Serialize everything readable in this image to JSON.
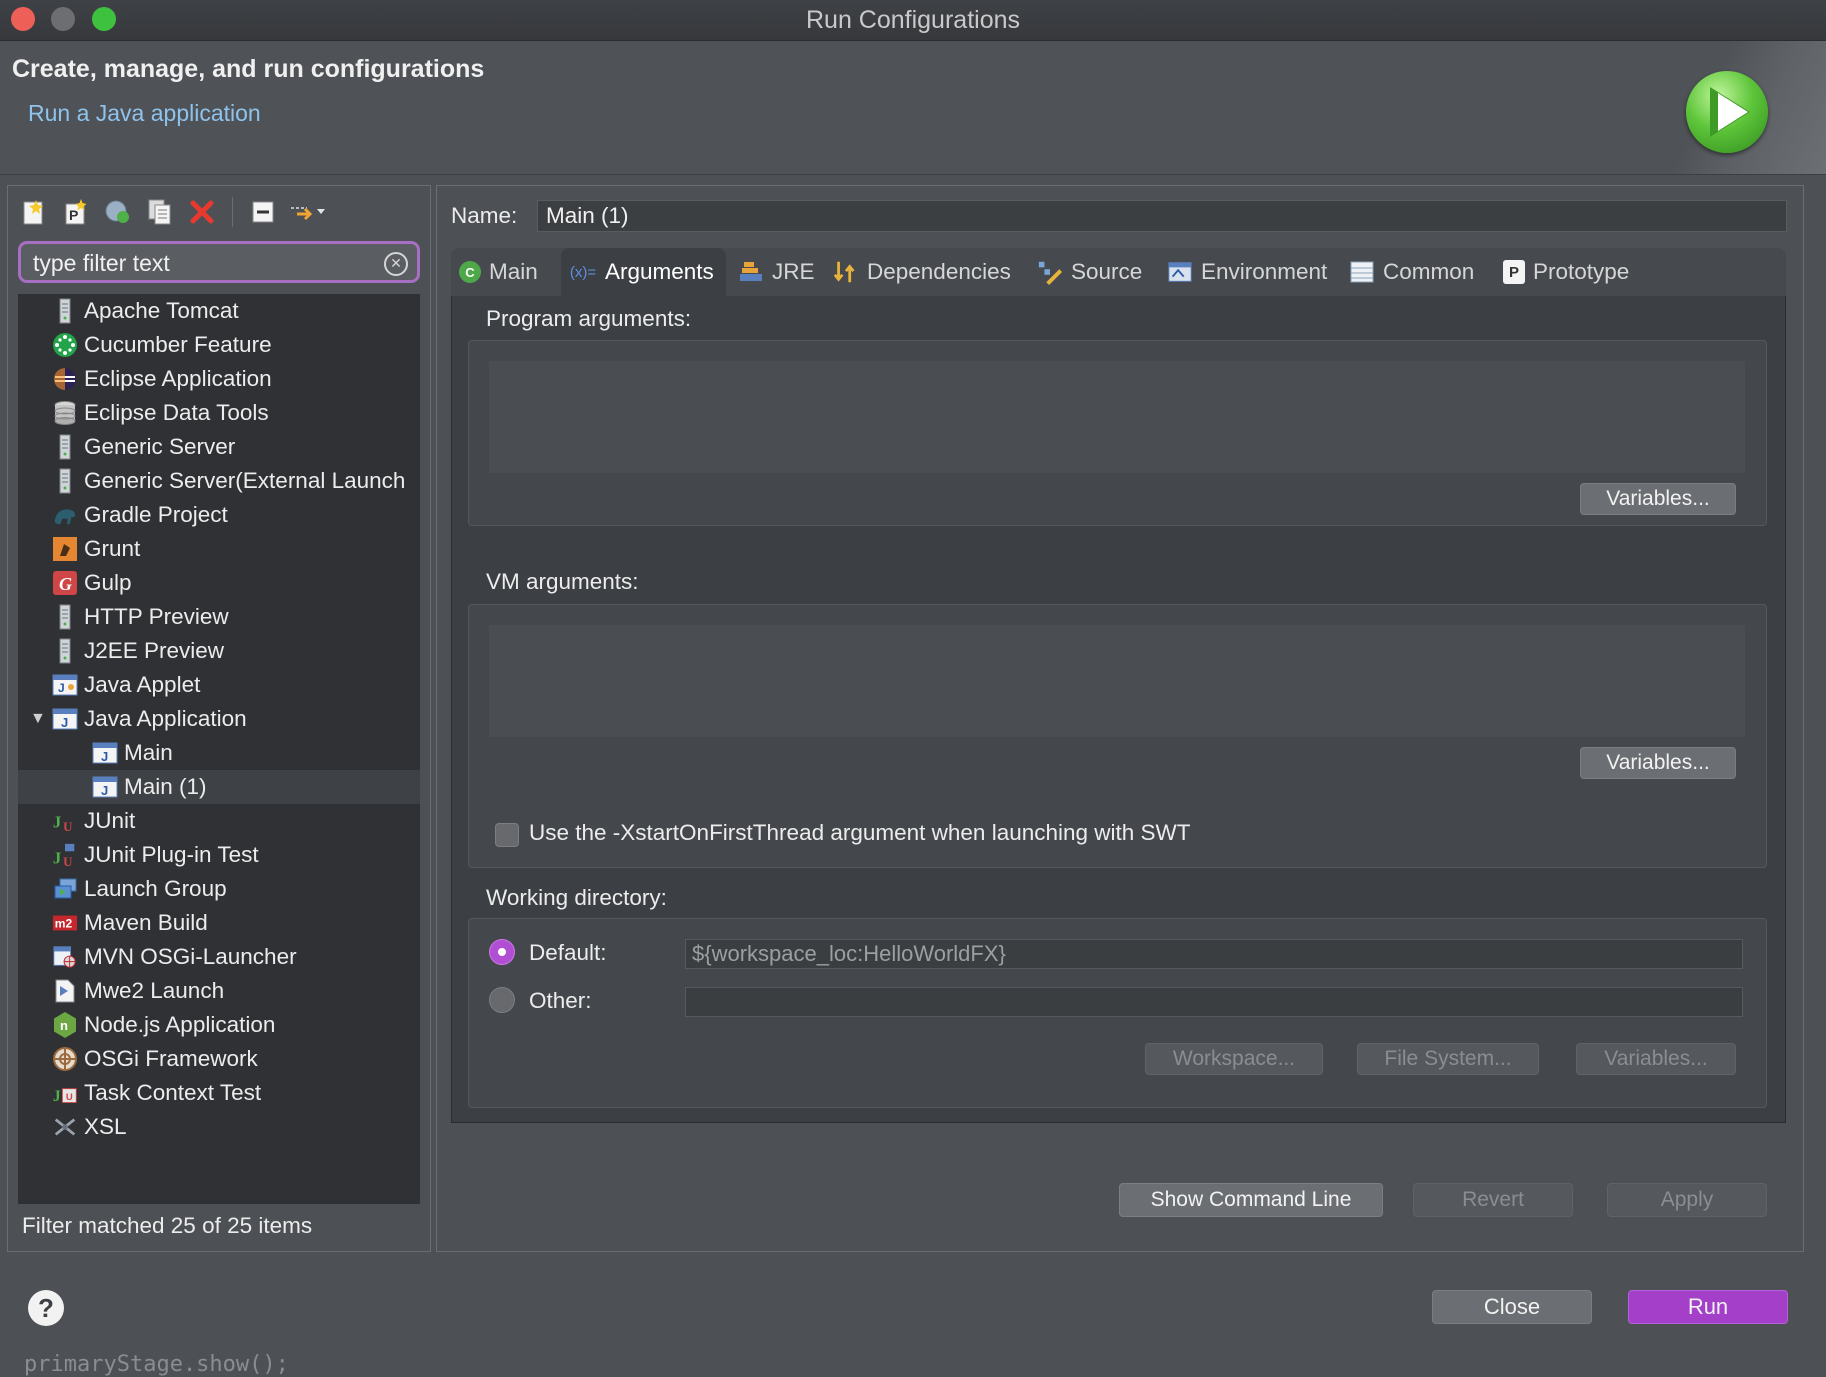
{
  "window": {
    "title": "Run Configurations"
  },
  "header": {
    "title": "Create, manage, and run configurations",
    "subtitle": "Run a Java application"
  },
  "left": {
    "toolbar": [
      "new-config-icon",
      "new-prototype-icon",
      "export-icon",
      "duplicate-icon",
      "delete-icon",
      "collapse-all-icon",
      "filter-menu-icon"
    ],
    "filter_placeholder": "type filter text",
    "tree": [
      {
        "label": "Apache Tomcat",
        "icon": "server-icon",
        "level": 0
      },
      {
        "label": "Cucumber Feature",
        "icon": "cucumber-icon",
        "level": 0
      },
      {
        "label": "Eclipse Application",
        "icon": "eclipse-icon",
        "level": 0
      },
      {
        "label": "Eclipse Data Tools",
        "icon": "database-icon",
        "level": 0
      },
      {
        "label": "Generic Server",
        "icon": "server-icon",
        "level": 0
      },
      {
        "label": "Generic Server(External Launch",
        "icon": "server-icon",
        "level": 0
      },
      {
        "label": "Gradle Project",
        "icon": "gradle-icon",
        "level": 0
      },
      {
        "label": "Grunt",
        "icon": "grunt-icon",
        "level": 0
      },
      {
        "label": "Gulp",
        "icon": "gulp-icon",
        "level": 0
      },
      {
        "label": "HTTP Preview",
        "icon": "server-icon",
        "level": 0
      },
      {
        "label": "J2EE Preview",
        "icon": "server-icon",
        "level": 0
      },
      {
        "label": "Java Applet",
        "icon": "applet-icon",
        "level": 0
      },
      {
        "label": "Java Application",
        "icon": "java-app-icon",
        "level": 0,
        "expanded": true
      },
      {
        "label": "Main",
        "icon": "java-app-icon",
        "level": 1
      },
      {
        "label": "Main (1)",
        "icon": "java-app-icon",
        "level": 1,
        "selected": true
      },
      {
        "label": "JUnit",
        "icon": "junit-icon",
        "level": 0
      },
      {
        "label": "JUnit Plug-in Test",
        "icon": "junit-plugin-icon",
        "level": 0
      },
      {
        "label": "Launch Group",
        "icon": "launch-group-icon",
        "level": 0
      },
      {
        "label": "Maven Build",
        "icon": "maven-icon",
        "level": 0
      },
      {
        "label": "MVN OSGi-Launcher",
        "icon": "osgi-launcher-icon",
        "level": 0
      },
      {
        "label": "Mwe2 Launch",
        "icon": "mwe2-icon",
        "level": 0
      },
      {
        "label": "Node.js Application",
        "icon": "nodejs-icon",
        "level": 0
      },
      {
        "label": "OSGi Framework",
        "icon": "osgi-icon",
        "level": 0
      },
      {
        "label": "Task Context Test",
        "icon": "task-test-icon",
        "level": 0
      },
      {
        "label": "XSL",
        "icon": "xsl-icon",
        "level": 0
      }
    ],
    "status": "Filter matched 25 of 25 items"
  },
  "right": {
    "name_label": "Name:",
    "name_value": "Main (1)",
    "tabs": [
      {
        "label": "Main",
        "icon": "main-class-icon"
      },
      {
        "label": "Arguments",
        "icon": "arguments-icon",
        "active": true
      },
      {
        "label": "JRE",
        "icon": "jre-icon"
      },
      {
        "label": "Dependencies",
        "icon": "dependencies-icon"
      },
      {
        "label": "Source",
        "icon": "source-icon"
      },
      {
        "label": "Environment",
        "icon": "environment-icon"
      },
      {
        "label": "Common",
        "icon": "common-icon"
      },
      {
        "label": "Prototype",
        "icon": "prototype-icon"
      }
    ],
    "program_args_label": "Program arguments:",
    "vm_args_label": "VM arguments:",
    "variables_label": "Variables...",
    "xstart_label": "Use the -XstartOnFirstThread argument when launching with SWT",
    "working_dir_label": "Working directory:",
    "default_label": "Default:",
    "default_value": "${workspace_loc:HelloWorldFX}",
    "other_label": "Other:",
    "workspace_btn": "Workspace...",
    "filesystem_btn": "File System...",
    "show_cmd_btn": "Show Command Line",
    "revert_btn": "Revert",
    "apply_btn": "Apply"
  },
  "footer": {
    "close_btn": "Close",
    "run_btn": "Run",
    "help_symbol": "?",
    "background_code": "primaryStage.show();"
  },
  "colors": {
    "accent": "#b04fd3",
    "link": "#8fc3ec",
    "background": "#4d5054"
  }
}
